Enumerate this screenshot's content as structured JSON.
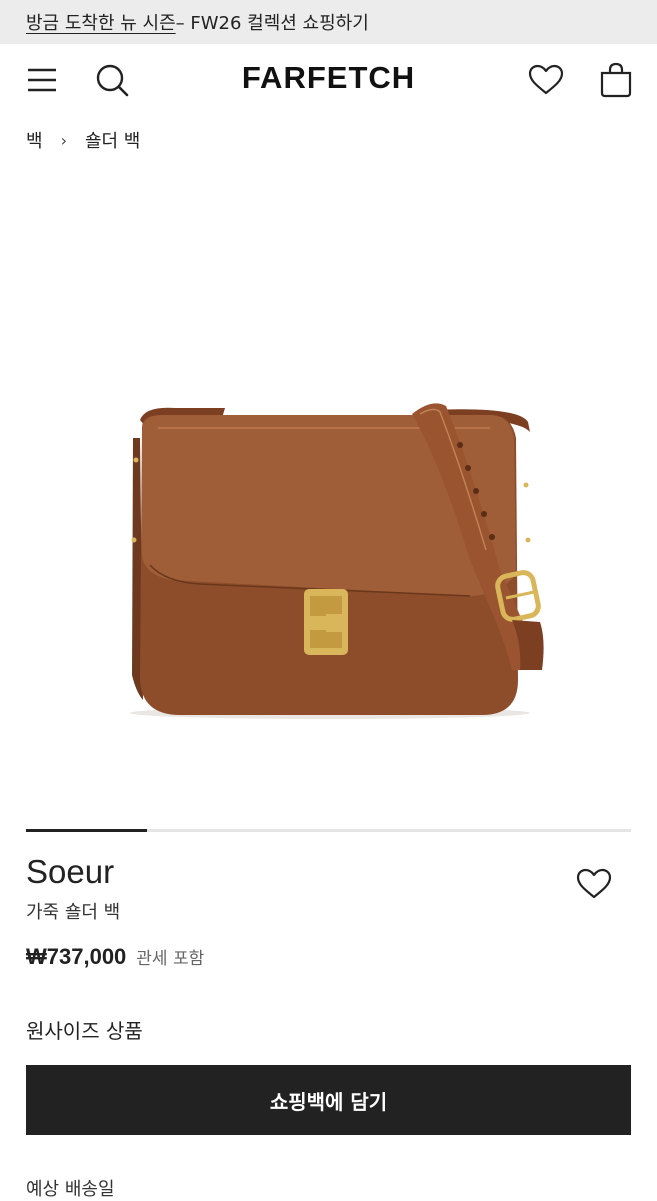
{
  "promo": {
    "link_text": "방금 도착한 뉴 시즌",
    "rest_text": " – FW26 컬렉션 쇼핑하기"
  },
  "header": {
    "logo": "FARFETCH"
  },
  "breadcrumb": {
    "items": [
      "백",
      "숄더 백"
    ],
    "separator": "›"
  },
  "product": {
    "brand": "Soeur",
    "name": "가죽 숄더 백",
    "price": "₩737,000",
    "tax_note": "관세 포함",
    "size_note": "원사이즈 상품",
    "add_to_bag": "쇼핑백에 담기",
    "delivery_label": "예상 배송일"
  },
  "carousel": {
    "current": 1,
    "total": 5
  },
  "colors": {
    "button_bg": "#222222",
    "promo_bg": "#ececec",
    "bag_leather": "#96532f",
    "hardware_gold": "#d9b65a"
  },
  "icons": [
    "menu-icon",
    "search-icon",
    "heart-icon",
    "shopping-bag-icon",
    "heart-outline-icon"
  ]
}
